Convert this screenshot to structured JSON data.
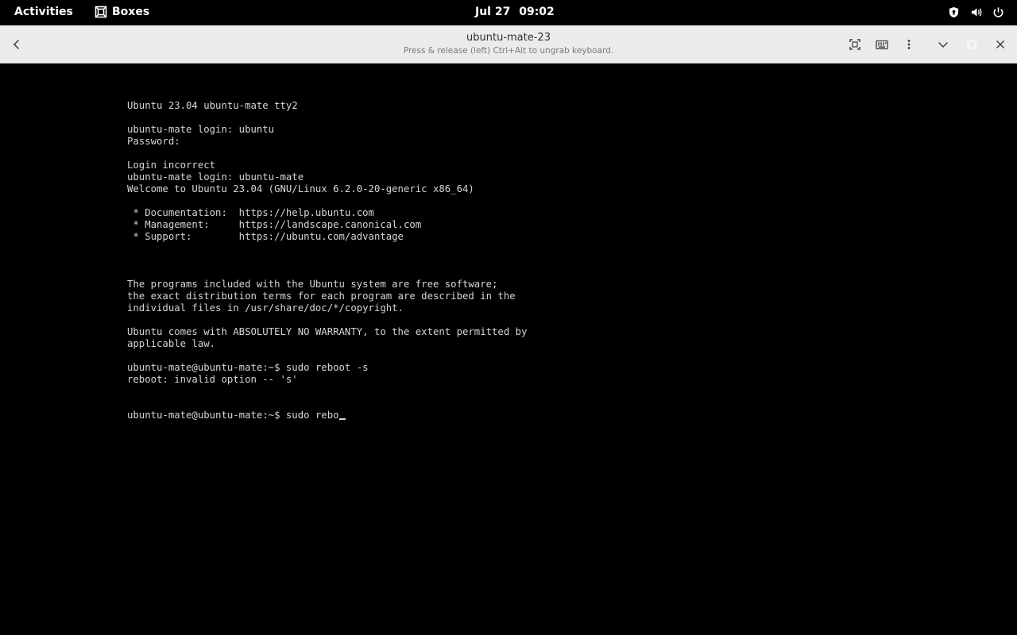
{
  "topbar": {
    "activities": "Activities",
    "app_name": "Boxes",
    "date": "Jul 27",
    "time": "09:02",
    "tray_icons": [
      "shield-icon",
      "volume-icon",
      "power-icon"
    ]
  },
  "headerbar": {
    "title": "ubuntu-mate-23",
    "subtitle": "Press & release (left) Ctrl+Alt to ungrab keyboard.",
    "buttons": [
      "back",
      "fullscreen",
      "keyboard",
      "menu",
      "dropdown",
      "spinner",
      "close"
    ]
  },
  "console": {
    "lines": [
      "Ubuntu 23.04 ubuntu-mate tty2",
      "",
      "ubuntu-mate login: ubuntu",
      "Password:",
      "",
      "Login incorrect",
      "ubuntu-mate login: ubuntu-mate",
      "Welcome to Ubuntu 23.04 (GNU/Linux 6.2.0-20-generic x86_64)",
      "",
      " * Documentation:  https://help.ubuntu.com",
      " * Management:     https://landscape.canonical.com",
      " * Support:        https://ubuntu.com/advantage",
      "",
      "",
      "",
      "The programs included with the Ubuntu system are free software;",
      "the exact distribution terms for each program are described in the",
      "individual files in /usr/share/doc/*/copyright.",
      "",
      "Ubuntu comes with ABSOLUTELY NO WARRANTY, to the extent permitted by",
      "applicable law.",
      "",
      "ubuntu-mate@ubuntu-mate:~$ sudo reboot -s",
      "reboot: invalid option -- 's'"
    ],
    "current_input": "ubuntu-mate@ubuntu-mate:~$ sudo rebo"
  },
  "colors": {
    "topbar_bg": "#000000",
    "headerbar_bg": "#ebebeb",
    "console_bg": "#000000",
    "console_fg": "#d6d6d6"
  }
}
